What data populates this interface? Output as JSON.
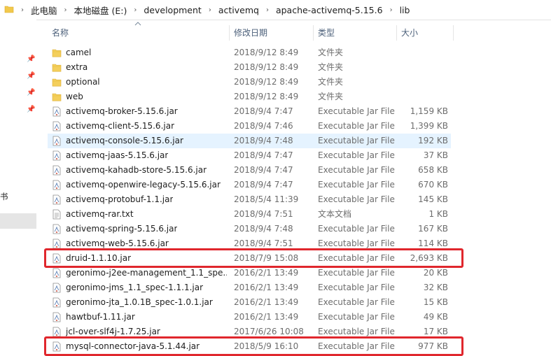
{
  "breadcrumb": [
    "此电脑",
    "本地磁盘 (E:)",
    "development",
    "activemq",
    "apache-activemq-5.15.6",
    "lib"
  ],
  "columns": {
    "name": "名称",
    "date": "修改日期",
    "type": "类型",
    "size": "大小"
  },
  "nav_fragment": "书",
  "files": [
    {
      "name": "camel",
      "date": "2018/9/12 8:49",
      "type": "文件夹",
      "size": "",
      "icon": "folder"
    },
    {
      "name": "extra",
      "date": "2018/9/12 8:49",
      "type": "文件夹",
      "size": "",
      "icon": "folder"
    },
    {
      "name": "optional",
      "date": "2018/9/12 8:49",
      "type": "文件夹",
      "size": "",
      "icon": "folder"
    },
    {
      "name": "web",
      "date": "2018/9/12 8:49",
      "type": "文件夹",
      "size": "",
      "icon": "folder"
    },
    {
      "name": "activemq-broker-5.15.6.jar",
      "date": "2018/9/4 7:47",
      "type": "Executable Jar File",
      "size": "1,159 KB",
      "icon": "jar"
    },
    {
      "name": "activemq-client-5.15.6.jar",
      "date": "2018/9/4 7:46",
      "type": "Executable Jar File",
      "size": "1,399 KB",
      "icon": "jar"
    },
    {
      "name": "activemq-console-5.15.6.jar",
      "date": "2018/9/4 7:48",
      "type": "Executable Jar File",
      "size": "192 KB",
      "icon": "jar",
      "hover": true
    },
    {
      "name": "activemq-jaas-5.15.6.jar",
      "date": "2018/9/4 7:47",
      "type": "Executable Jar File",
      "size": "37 KB",
      "icon": "jar"
    },
    {
      "name": "activemq-kahadb-store-5.15.6.jar",
      "date": "2018/9/4 7:47",
      "type": "Executable Jar File",
      "size": "658 KB",
      "icon": "jar"
    },
    {
      "name": "activemq-openwire-legacy-5.15.6.jar",
      "date": "2018/9/4 7:47",
      "type": "Executable Jar File",
      "size": "670 KB",
      "icon": "jar"
    },
    {
      "name": "activemq-protobuf-1.1.jar",
      "date": "2018/5/4 11:39",
      "type": "Executable Jar File",
      "size": "145 KB",
      "icon": "jar"
    },
    {
      "name": "activemq-rar.txt",
      "date": "2018/9/4 7:51",
      "type": "文本文档",
      "size": "1 KB",
      "icon": "txt"
    },
    {
      "name": "activemq-spring-5.15.6.jar",
      "date": "2018/9/4 7:48",
      "type": "Executable Jar File",
      "size": "167 KB",
      "icon": "jar"
    },
    {
      "name": "activemq-web-5.15.6.jar",
      "date": "2018/9/4 7:51",
      "type": "Executable Jar File",
      "size": "114 KB",
      "icon": "jar"
    },
    {
      "name": "druid-1.1.10.jar",
      "date": "2018/7/9 15:08",
      "type": "Executable Jar File",
      "size": "2,693 KB",
      "icon": "jar",
      "marked": true
    },
    {
      "name": "geronimo-j2ee-management_1.1_spe...",
      "date": "2016/2/1 13:49",
      "type": "Executable Jar File",
      "size": "20 KB",
      "icon": "jar"
    },
    {
      "name": "geronimo-jms_1.1_spec-1.1.1.jar",
      "date": "2016/2/1 13:49",
      "type": "Executable Jar File",
      "size": "32 KB",
      "icon": "jar"
    },
    {
      "name": "geronimo-jta_1.0.1B_spec-1.0.1.jar",
      "date": "2016/2/1 13:49",
      "type": "Executable Jar File",
      "size": "15 KB",
      "icon": "jar"
    },
    {
      "name": "hawtbuf-1.11.jar",
      "date": "2016/2/1 13:49",
      "type": "Executable Jar File",
      "size": "49 KB",
      "icon": "jar"
    },
    {
      "name": "jcl-over-slf4j-1.7.25.jar",
      "date": "2017/6/26 10:08",
      "type": "Executable Jar File",
      "size": "17 KB",
      "icon": "jar"
    },
    {
      "name": "mysql-connector-java-5.1.44.jar",
      "date": "2018/5/9 16:10",
      "type": "Executable Jar File",
      "size": "977 KB",
      "icon": "jar",
      "marked": true
    }
  ]
}
